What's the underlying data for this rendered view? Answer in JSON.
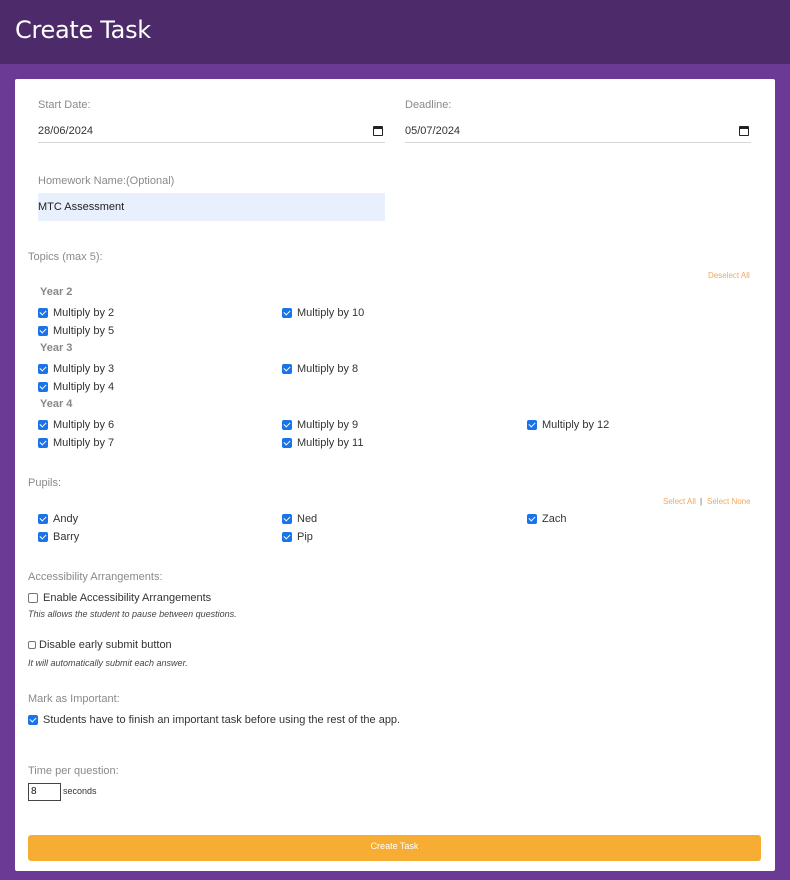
{
  "page": {
    "title": "Create Task"
  },
  "dates": {
    "start_label": "Start Date:",
    "start_value": "28/06/2024",
    "deadline_label": "Deadline:",
    "deadline_value": "05/07/2024"
  },
  "homework": {
    "label": "Homework Name:(Optional)",
    "value": "MTC Assessment"
  },
  "topics": {
    "label": "Topics (max 5):",
    "deselect_all": "Deselect All",
    "years": [
      {
        "name": "Year 2",
        "items": [
          {
            "label": "Multiply by 2",
            "checked": true
          },
          {
            "label": "Multiply by 10",
            "checked": true
          },
          {
            "label": "Multiply by 5",
            "checked": true
          }
        ]
      },
      {
        "name": "Year 3",
        "items": [
          {
            "label": "Multiply by 3",
            "checked": true
          },
          {
            "label": "Multiply by 8",
            "checked": true
          },
          {
            "label": "Multiply by 4",
            "checked": true
          }
        ]
      },
      {
        "name": "Year 4",
        "items": [
          {
            "label": "Multiply by 6",
            "checked": true
          },
          {
            "label": "Multiply by 9",
            "checked": true
          },
          {
            "label": "Multiply by 12",
            "checked": true
          },
          {
            "label": "Multiply by 7",
            "checked": true
          },
          {
            "label": "Multiply by 11",
            "checked": true
          }
        ]
      }
    ]
  },
  "pupils": {
    "label": "Pupils:",
    "select_all": "Select All",
    "separator": "|",
    "select_none": "Select None",
    "items": [
      {
        "label": "Andy",
        "checked": true
      },
      {
        "label": "Ned",
        "checked": true
      },
      {
        "label": "Zach",
        "checked": true
      },
      {
        "label": "Barry",
        "checked": true
      },
      {
        "label": "Pip",
        "checked": true
      }
    ]
  },
  "accessibility": {
    "label": "Accessibility Arrangements:",
    "enable_label": "Enable Accessibility Arrangements",
    "enable_checked": false,
    "enable_note": "This allows the student to pause between questions.",
    "disable_submit_label": "Disable early submit button",
    "disable_submit_checked": false,
    "disable_submit_note": "It will automatically submit each answer."
  },
  "important": {
    "label": "Mark as Important:",
    "checkbox_label": "Students have to finish an important task before using the rest of the app.",
    "checked": true
  },
  "time": {
    "label": "Time per question:",
    "value": "8",
    "unit": "seconds"
  },
  "submit": {
    "label": "Create Task"
  },
  "colors": {
    "header": "#4d2b6b",
    "background": "#6b3a94",
    "accent": "#f7ad34",
    "checkbox": "#1a73e8",
    "link": "#f0a85a"
  },
  "icons": {
    "date_picker": "calendar-icon",
    "checkbox": "checkmark-icon"
  }
}
